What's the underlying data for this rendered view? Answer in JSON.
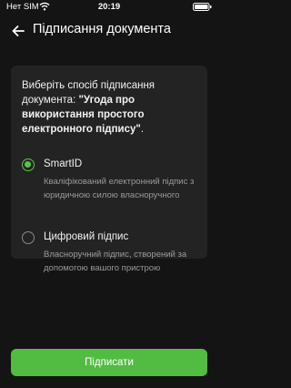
{
  "status_bar": {
    "carrier": "Нет SIM",
    "time": "20:19"
  },
  "header": {
    "title": "Підписання документа"
  },
  "prompt": {
    "text": "Виберіть спосіб підписання документа: ",
    "document_name": "\"Угода про використання простого електронного підпису\"",
    "suffix": "."
  },
  "options": [
    {
      "title": "SmartID",
      "description": "Кваліфікований електронний підпис з юридичною силою власноручного",
      "selected": true
    },
    {
      "title": "Цифровий підпис",
      "description": "Власноручний підпис, створений за допомогою вашого пристрою",
      "selected": false
    }
  ],
  "actions": {
    "sign_label": "Підписати"
  },
  "colors": {
    "accent": "#52bb41",
    "background": "#141414",
    "card": "#232323"
  }
}
